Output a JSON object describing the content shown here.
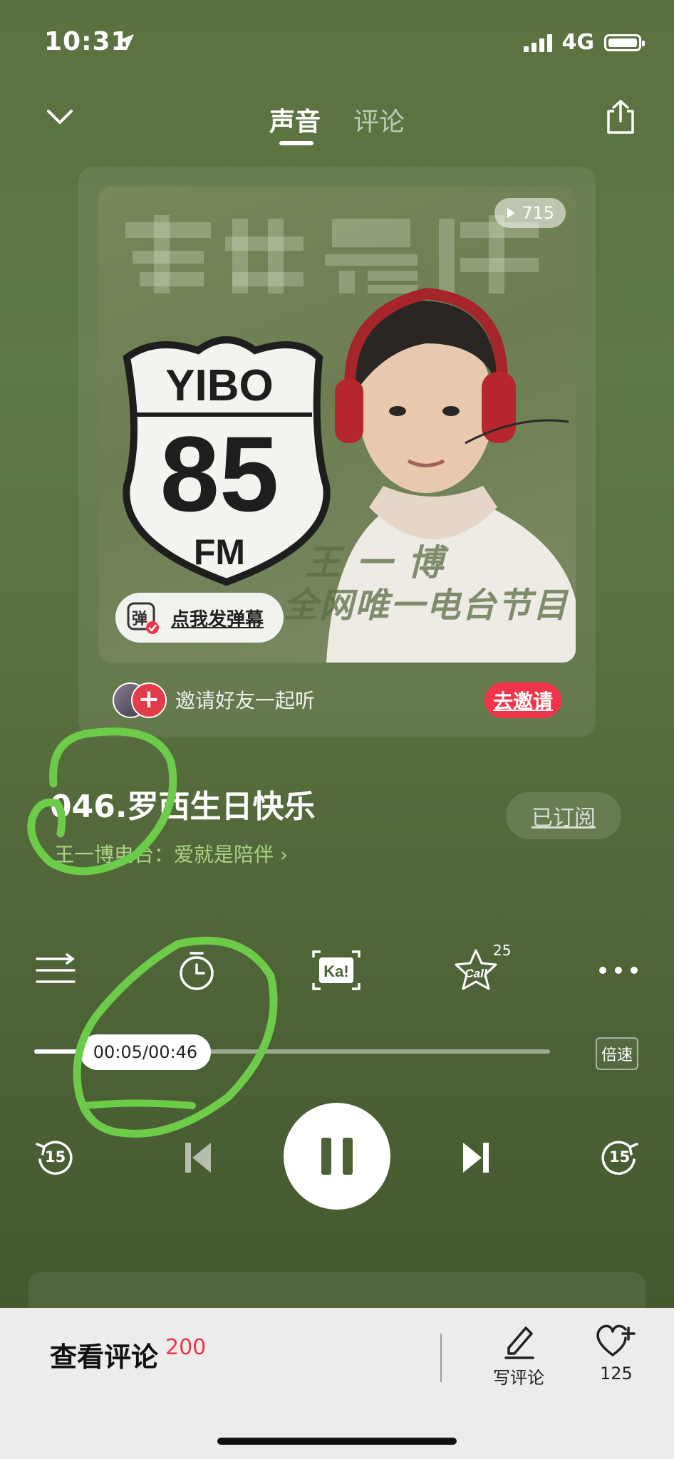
{
  "status": {
    "time": "10:31",
    "network": "4G"
  },
  "nav": {
    "tabs": [
      {
        "label": "声音"
      },
      {
        "label": "评论"
      }
    ]
  },
  "cover": {
    "play_count": "715",
    "danmu_icon_char": "弹",
    "danmu_label": "点我发弹幕"
  },
  "invite": {
    "avatar_plus": "+",
    "text": "邀请好友一起听",
    "button": "去邀请"
  },
  "track": {
    "title": "046.罗西生日快乐",
    "album": "王一博电台：爱就是陪伴 ›",
    "subscribe_label": "已订阅"
  },
  "actions": {
    "call_count": "25"
  },
  "progress": {
    "current": "00:05",
    "total": "00:46",
    "time_display": "00:05/00:46",
    "fraction": 0.11,
    "speed_label": "倍速"
  },
  "controls": {
    "rewind": "15",
    "forward": "15"
  },
  "bottom": {
    "comments_label": "查看评论",
    "comments_count": "200",
    "write_label": "写评论",
    "like_count": "125"
  }
}
